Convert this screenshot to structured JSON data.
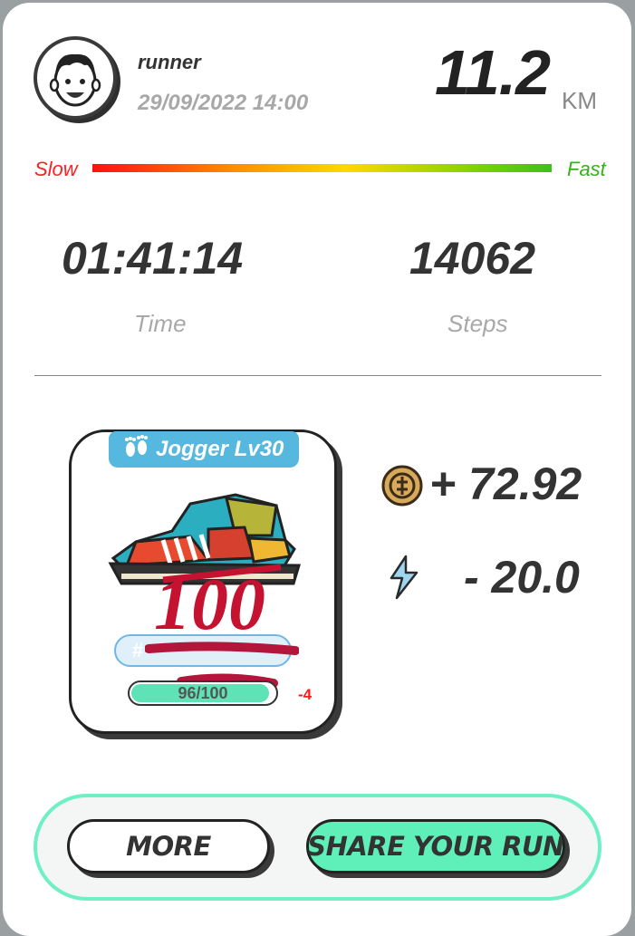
{
  "user": {
    "name": "runner",
    "datetime": "29/09/2022 14:00",
    "avatar_icon": "cartoon-face-avatar"
  },
  "distance": {
    "value": "11.2",
    "unit": "KM"
  },
  "speed": {
    "slow_label": "Slow",
    "fast_label": "Fast",
    "slow_color": "#ff2020",
    "fast_color": "#35b21a"
  },
  "stats": {
    "time": {
      "value": "01:41:14",
      "label": "Time"
    },
    "steps": {
      "value": "14062",
      "label": "Steps"
    }
  },
  "sneaker": {
    "level_label": "Jogger Lv30",
    "level_icon": "footprints-icon",
    "score_overlay": "100",
    "id_prefix": "#",
    "durability_text": "96/100",
    "durability_fraction": 0.96,
    "durability_delta": "-4",
    "badge_color": "#56b8de"
  },
  "earnings": {
    "coin_icon": "gst-coin-icon",
    "reward_text": "+ 72.92",
    "energy_icon": "lightning-bolt-icon",
    "energy_text": "- 20.0"
  },
  "actions": {
    "more_label": "MORE",
    "share_label": "SHARE YOUR RUN",
    "accent": "#5ff0b9"
  }
}
